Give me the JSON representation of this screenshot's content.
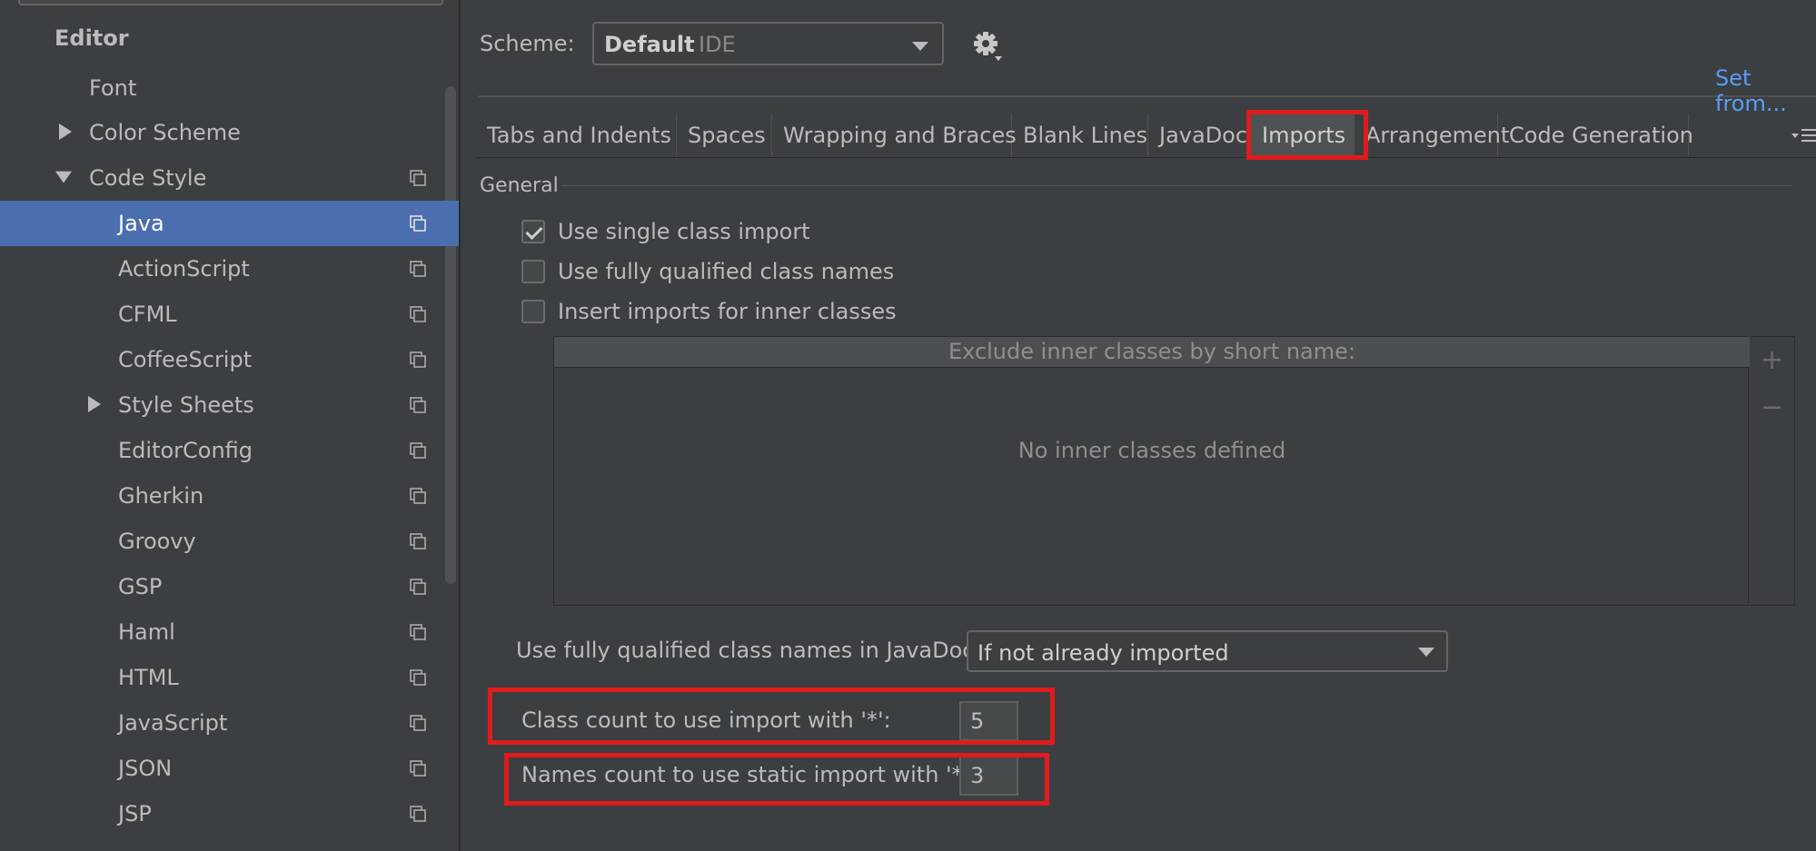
{
  "sidebar": {
    "heading": "Editor",
    "items": [
      {
        "label": "Font"
      },
      {
        "label": "Color Scheme"
      },
      {
        "label": "Code Style"
      },
      {
        "label": "Java"
      },
      {
        "label": "ActionScript"
      },
      {
        "label": "CFML"
      },
      {
        "label": "CoffeeScript"
      },
      {
        "label": "Style Sheets"
      },
      {
        "label": "EditorConfig"
      },
      {
        "label": "Gherkin"
      },
      {
        "label": "Groovy"
      },
      {
        "label": "GSP"
      },
      {
        "label": "Haml"
      },
      {
        "label": "HTML"
      },
      {
        "label": "JavaScript"
      },
      {
        "label": "JSON"
      },
      {
        "label": "JSP"
      }
    ],
    "selected": "Java"
  },
  "scheme": {
    "label": "Scheme:",
    "value": "Default",
    "value_suffix": "IDE",
    "set_from_link": "Set from..."
  },
  "tabs": [
    {
      "label": "Tabs and Indents"
    },
    {
      "label": "Spaces"
    },
    {
      "label": "Wrapping and Braces"
    },
    {
      "label": "Blank Lines"
    },
    {
      "label": "JavaDoc"
    },
    {
      "label": "Imports"
    },
    {
      "label": "Arrangement"
    },
    {
      "label": "Code Generation"
    }
  ],
  "active_tab": "Imports",
  "general": {
    "section_title": "General",
    "use_single_class_import": {
      "label": "Use single class import",
      "checked": true
    },
    "use_fully_qualified": {
      "label": "Use fully qualified class names",
      "checked": false
    },
    "insert_imports_inner": {
      "label": "Insert imports for inner classes",
      "checked": false
    },
    "exclude_table": {
      "header": "Exclude inner classes by short name:",
      "empty_text": "No inner classes defined",
      "add_symbol": "+",
      "remove_symbol": "−"
    },
    "javadoc_fq": {
      "label": "Use fully qualified class names in JavaDoc:",
      "value": "If not already imported"
    },
    "class_count": {
      "label": "Class count to use import with '*':",
      "value": "5"
    },
    "names_count": {
      "label": "Names count to use static import with '*':",
      "value": "3"
    }
  },
  "colors": {
    "background": "#3c3f41",
    "selection": "#4b6eaf",
    "highlight": "#e11b1b",
    "link": "#589df6"
  }
}
